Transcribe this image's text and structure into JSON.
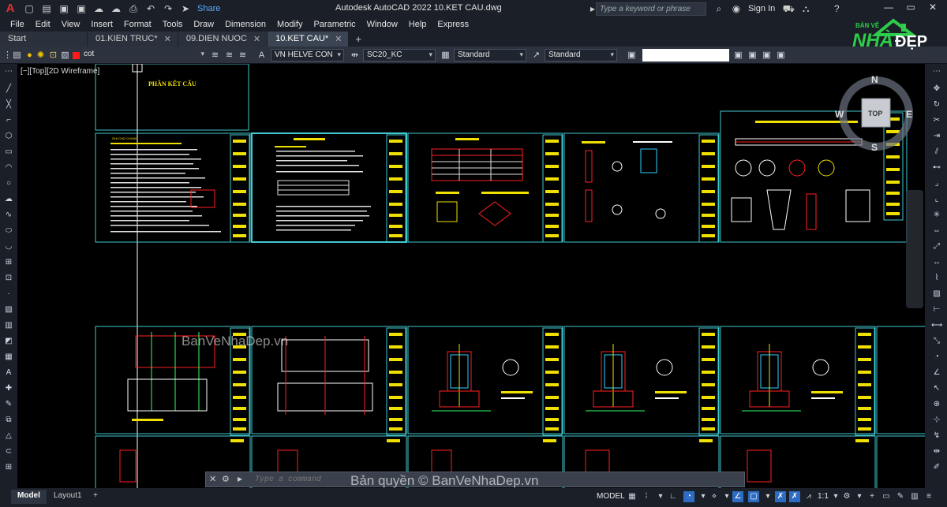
{
  "titlebar": {
    "app_letter": "A",
    "share": "Share",
    "title": "Autodesk AutoCAD 2022    10.KET CAU.dwg",
    "search_placeholder": "Type a keyword or phrase",
    "sign_in": "Sign In",
    "help": "?"
  },
  "menu": [
    "File",
    "Edit",
    "View",
    "Insert",
    "Format",
    "Tools",
    "Draw",
    "Dimension",
    "Modify",
    "Parametric",
    "Window",
    "Help",
    "Express"
  ],
  "tabs": [
    {
      "label": "Start",
      "closable": false,
      "active": false
    },
    {
      "label": "01.KIEN TRUC*",
      "closable": true,
      "active": false
    },
    {
      "label": "09.DIEN NUOC",
      "closable": true,
      "active": false
    },
    {
      "label": "10.KET CAU*",
      "closable": true,
      "active": true
    }
  ],
  "toolbar": {
    "layer": "cot",
    "text_style": "VN HELVE CON",
    "dim_style": "SC20_KC",
    "table_style": "Standard",
    "mleader_style": "Standard"
  },
  "viewport": {
    "label": "[−][Top][2D Wireframe]",
    "compass": {
      "n": "N",
      "s": "S",
      "e": "E",
      "w": "W",
      "top": "TOP"
    }
  },
  "drawing": {
    "header_title": "PHẦN KẾT CẤU",
    "sheet_title": "GHI CHÚ CHUNG"
  },
  "watermark": {
    "center": "BanVeNhaDep.vn",
    "bottom": "Bản quyền © BanVeNhaDep.vn",
    "logo_top": "BẢN VẼ",
    "logo_nha": "NHÀ",
    "logo_dep": "ĐẸP"
  },
  "command": {
    "placeholder": "Type a command"
  },
  "status": {
    "layouts": [
      "Model",
      "Layout1"
    ],
    "model": "MODEL",
    "scale": "1:1"
  },
  "colors": {
    "accent": "#2e6cc4",
    "frame": "#41c8d0",
    "text_yellow": "#f0e000"
  }
}
